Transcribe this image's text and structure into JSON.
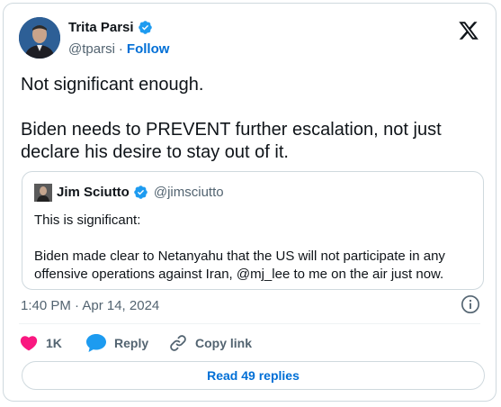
{
  "author": {
    "name": "Trita Parsi",
    "handle": "@tparsi",
    "separator": "·",
    "follow_label": "Follow"
  },
  "tweet": {
    "text": "Not significant enough.\n\nBiden needs to PREVENT further escalation, not just declare his desire to stay out of it."
  },
  "quote": {
    "name": "Jim Sciutto",
    "handle": "@jimsciutto",
    "text": "This is significant:\n\nBiden made clear to Netanyahu that the US will not participate in any offensive operations against Iran, @mj_lee to me on the air just now."
  },
  "meta": {
    "timestamp": "1:40 PM · Apr 14, 2024"
  },
  "actions": {
    "like_count": "1K",
    "reply_label": "Reply",
    "copy_label": "Copy link"
  },
  "footer": {
    "read_replies_label": "Read 49 replies"
  },
  "colors": {
    "accent": "#006fd6",
    "verified": "#1d9bf0",
    "like": "#f91880",
    "text": "#0f1419",
    "secondary": "#536471",
    "border": "#cfd9de"
  },
  "icons": {
    "brand": "x-logo-icon",
    "verified": "verified-badge-icon",
    "info": "info-icon",
    "like": "heart-icon",
    "reply": "speech-bubble-icon",
    "copy": "link-icon"
  }
}
